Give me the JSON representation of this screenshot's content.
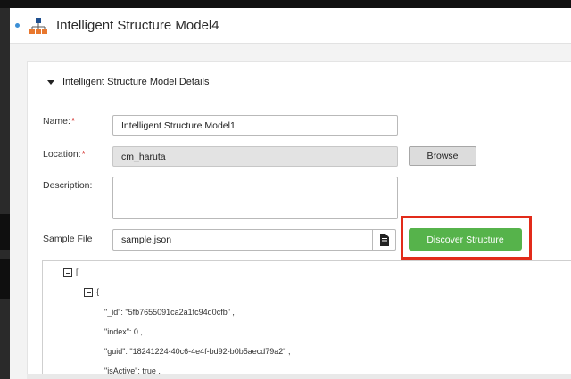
{
  "header": {
    "title": "Intelligent Structure Model4",
    "icon": "hierarchy-structure-icon",
    "accent": "#3b8fd6"
  },
  "section": {
    "title": "Intelligent Structure Model Details"
  },
  "form": {
    "name_label": "Name:",
    "name_value": "Intelligent Structure Model1",
    "location_label": "Location:",
    "location_value": "cm_haruta",
    "required_mark": "*",
    "browse_label": "Browse",
    "description_label": "Description:",
    "description_value": "",
    "sample_file_label": "Sample File",
    "sample_file_value": "sample.json",
    "discover_label": "Discover Structure",
    "discover_color": "#56b34b",
    "highlight_color": "#e22b1a"
  },
  "json_preview": {
    "line1": "[",
    "line2": "{",
    "line3": "\"_id\": \"5fb7655091ca2a1fc94d0cfb\" ,",
    "line4": "\"index\": 0 ,",
    "line5": "\"guid\": \"18241224-40c6-4e4f-bd92-b0b5aecd79a2\" ,",
    "line6": "\"isActive\": true ,"
  }
}
